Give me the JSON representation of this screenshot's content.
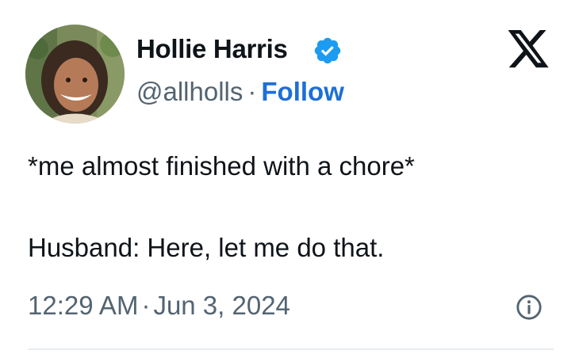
{
  "author": {
    "display_name": "Hollie Harris",
    "handle": "@allholls",
    "separator": "·",
    "follow_label": "Follow",
    "verified": true
  },
  "icons": {
    "verified": "verified-badge-icon",
    "platform": "x-logo-icon",
    "info": "info-icon"
  },
  "tweet": {
    "lines": [
      "*me almost finished with a chore*",
      "Husband: Here, let me do that."
    ],
    "time": "12:29 AM",
    "separator": "·",
    "date": "Jun 3, 2024"
  },
  "colors": {
    "text": "#0f1419",
    "secondary": "#536471",
    "link": "#1d6fd6",
    "verified": "#1d9bf0"
  }
}
